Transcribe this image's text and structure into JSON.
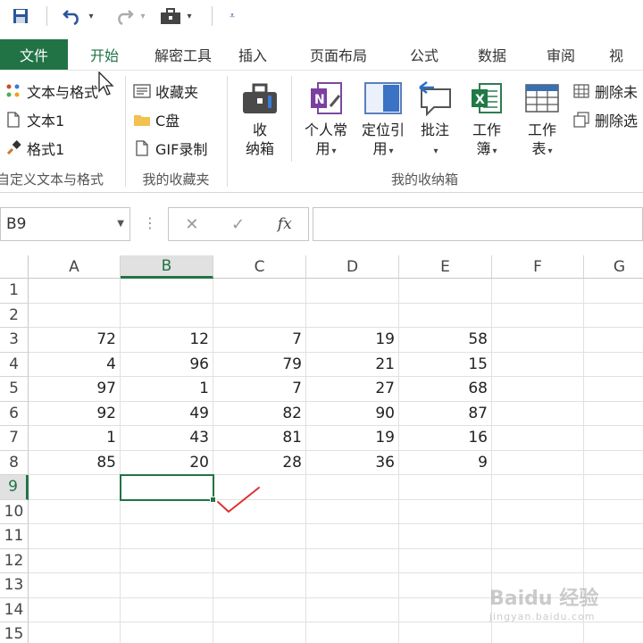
{
  "qat": {
    "save_icon": "save-icon",
    "undo_icon": "undo-icon",
    "redo_icon": "redo-icon",
    "toolbox_icon": "toolbox-icon",
    "customize_icon": "customize-icon"
  },
  "tabs": [
    {
      "label": "文件",
      "kind": "file"
    },
    {
      "label": "开始",
      "kind": "active"
    },
    {
      "label": "解密工具",
      "kind": ""
    },
    {
      "label": "插入",
      "kind": ""
    },
    {
      "label": "页面布局",
      "kind": ""
    },
    {
      "label": "公式",
      "kind": ""
    },
    {
      "label": "数据",
      "kind": ""
    },
    {
      "label": "审阅",
      "kind": ""
    },
    {
      "label": "视",
      "kind": ""
    }
  ],
  "ribbon": {
    "group1": {
      "title": "自定义文本与格式",
      "items": [
        "文本与格式",
        "文本1",
        "格式1"
      ]
    },
    "group2": {
      "title": "我的收藏夹",
      "items": [
        "收藏夹",
        "C盘",
        "GIF录制"
      ]
    },
    "group3": {
      "title": "我的收纳箱",
      "big_buttons": [
        {
          "line1": "收",
          "line2": "纳箱"
        },
        {
          "line1": "个人常",
          "line2": "用"
        },
        {
          "line1": "定位引",
          "line2": "用"
        },
        {
          "line1": "批注",
          "line2": ""
        },
        {
          "line1": "工作",
          "line2": "簿"
        },
        {
          "line1": "工作",
          "line2": "表"
        }
      ],
      "small_buttons": [
        "删除未",
        "删除选"
      ]
    }
  },
  "formula_bar": {
    "name_box": "B9",
    "cancel_symbol": "✕",
    "confirm_symbol": "✓",
    "fx_symbol": "fx",
    "formula": ""
  },
  "sheet": {
    "columns": [
      "A",
      "B",
      "C",
      "D",
      "E",
      "F",
      "G"
    ],
    "rows": [
      "1",
      "2",
      "3",
      "4",
      "5",
      "6",
      "7",
      "8",
      "9",
      "10",
      "11",
      "12",
      "13",
      "14",
      "15"
    ],
    "selected_column": "B",
    "selected_row": "9",
    "selected_cell": "B9",
    "values": [
      [
        "",
        "",
        "",
        "",
        "",
        "",
        ""
      ],
      [
        "",
        "",
        "",
        "",
        "",
        "",
        ""
      ],
      [
        "72",
        "12",
        "7",
        "19",
        "58",
        "",
        ""
      ],
      [
        "4",
        "96",
        "79",
        "21",
        "15",
        "",
        ""
      ],
      [
        "97",
        "1",
        "7",
        "27",
        "68",
        "",
        ""
      ],
      [
        "92",
        "49",
        "82",
        "90",
        "87",
        "",
        ""
      ],
      [
        "1",
        "43",
        "81",
        "19",
        "16",
        "",
        ""
      ],
      [
        "85",
        "20",
        "28",
        "36",
        "9",
        "",
        ""
      ],
      [
        "",
        "",
        "",
        "",
        "",
        "",
        ""
      ],
      [
        "",
        "",
        "",
        "",
        "",
        "",
        ""
      ],
      [
        "",
        "",
        "",
        "",
        "",
        "",
        ""
      ],
      [
        "",
        "",
        "",
        "",
        "",
        "",
        ""
      ],
      [
        "",
        "",
        "",
        "",
        "",
        "",
        ""
      ],
      [
        "",
        "",
        "",
        "",
        "",
        "",
        ""
      ],
      [
        "",
        "",
        "",
        "",
        "",
        "",
        ""
      ]
    ]
  },
  "annotation": {
    "kind": "red-checkmark",
    "color": "#e03030"
  },
  "watermark": {
    "main": "Bai",
    "paw": "du",
    "cn": "经验",
    "sub": "jingyan.baidu.com"
  },
  "colors": {
    "accent": "#217346",
    "file_tab": "#217346"
  }
}
